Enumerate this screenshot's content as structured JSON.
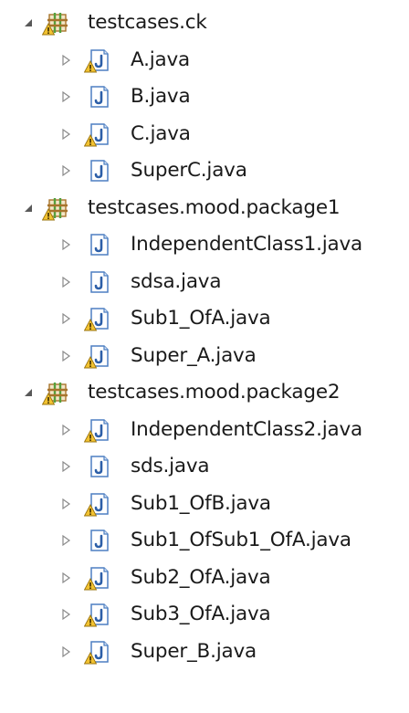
{
  "icons": {
    "expanded": "expanded-triangle-icon",
    "collapsed": "collapsed-triangle-icon",
    "package": "package-icon",
    "java_file": "java-file-icon",
    "warning": "warning-icon"
  },
  "colors": {
    "text": "#1a1a1a",
    "package_green": "#55a03c",
    "package_brown": "#a8742c",
    "file_blue": "#4d7fc2",
    "warning_yellow": "#f2c230",
    "twisty": "#8a8a8a"
  },
  "tree": [
    {
      "label": "testcases.ck",
      "warning": true,
      "children": [
        {
          "label": "A.java",
          "warning": true
        },
        {
          "label": "B.java",
          "warning": false
        },
        {
          "label": "C.java",
          "warning": true
        },
        {
          "label": "SuperC.java",
          "warning": false
        }
      ]
    },
    {
      "label": "testcases.mood.package1",
      "warning": true,
      "children": [
        {
          "label": "IndependentClass1.java",
          "warning": false
        },
        {
          "label": "sdsa.java",
          "warning": false
        },
        {
          "label": "Sub1_OfA.java",
          "warning": true
        },
        {
          "label": "Super_A.java",
          "warning": true
        }
      ]
    },
    {
      "label": "testcases.mood.package2",
      "warning": true,
      "children": [
        {
          "label": "IndependentClass2.java",
          "warning": true
        },
        {
          "label": "sds.java",
          "warning": false
        },
        {
          "label": "Sub1_OfB.java",
          "warning": true
        },
        {
          "label": "Sub1_OfSub1_OfA.java",
          "warning": false
        },
        {
          "label": "Sub2_OfA.java",
          "warning": true
        },
        {
          "label": "Sub3_OfA.java",
          "warning": true
        },
        {
          "label": "Super_B.java",
          "warning": true
        }
      ]
    }
  ]
}
